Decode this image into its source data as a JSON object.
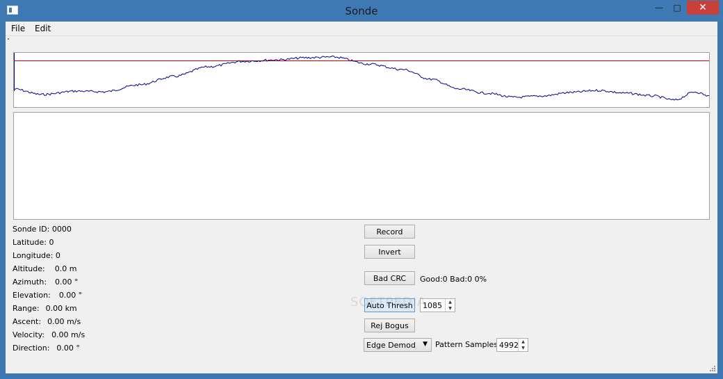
{
  "window": {
    "title": "Sonde",
    "minimize": "—",
    "maximize": "□",
    "close": "✕"
  },
  "menu": {
    "file": "File",
    "edit": "Edit"
  },
  "colors": {
    "threshold_line": "#d40000",
    "signal_line": "#00008b"
  },
  "waveform": {
    "icon": "waveform-plot",
    "threshold_level": 0.86
  },
  "info": {
    "sonde_id": "Sonde ID: 0000",
    "latitude": "Latitude: 0",
    "longitude": "Longitude: 0",
    "altitude_label": "Altitude:",
    "altitude_value": "0.0 m",
    "azimuth_label": "Azimuth:",
    "azimuth_value": "0.00 °",
    "elevation_label": "Elevation:",
    "elevation_value": "0.00 °",
    "range_label": "Range:",
    "range_value": "0.00 km",
    "ascent_label": "Ascent:",
    "ascent_value": "0.00 m/s",
    "velocity_label": "Velocity:",
    "velocity_value": "0.00 m/s",
    "direction_label": "Direction:",
    "direction_value": "0.00 °"
  },
  "controls": {
    "record": "Record",
    "invert": "Invert",
    "bad_crc": "Bad CRC",
    "crc_stats": "Good:0 Bad:0 0%",
    "auto_thresh": "Auto Thresh",
    "thresh_value": "1085",
    "rej_bogus": "Rej Bogus",
    "demod": "Edge Demod",
    "pattern_label": "Pattern Samples:",
    "pattern_value": "4992"
  },
  "watermark": "SOFTPEDIA"
}
